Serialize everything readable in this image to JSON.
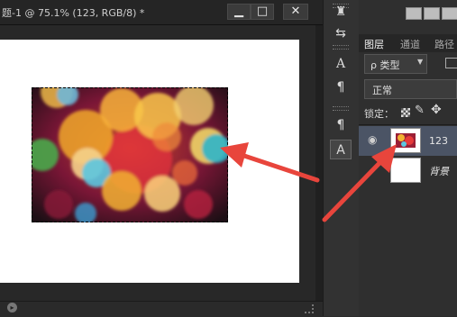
{
  "document": {
    "title": "题-1 @ 75.1% (123, RGB/8) *",
    "window_buttons": {
      "minimize": "▁",
      "maximize": "□",
      "close": "✕"
    }
  },
  "toolstrip": {
    "tools": [
      {
        "icon": "brush-icon",
        "glyph": "♜"
      },
      {
        "icon": "adjust-icon",
        "glyph": "⇆"
      },
      {
        "icon": "character-icon",
        "glyph": "A"
      },
      {
        "icon": "paragraph-icon",
        "glyph": "¶"
      },
      {
        "icon": "paragraph-style-icon",
        "glyph": "¶"
      },
      {
        "icon": "character-style-icon",
        "glyph": "A"
      }
    ]
  },
  "layers_panel": {
    "tabs": [
      "图层",
      "通道",
      "路径"
    ],
    "filter_label": "ρ 类型",
    "blend_mode": "正常",
    "lock_label": "锁定：",
    "layers": [
      {
        "name": "123",
        "visible": true,
        "selected": true
      },
      {
        "name": "背景",
        "visible": false,
        "selected": false
      }
    ]
  },
  "colors": {
    "accent_arrow": "#e8453c",
    "selected_layer": "#4b5465"
  }
}
